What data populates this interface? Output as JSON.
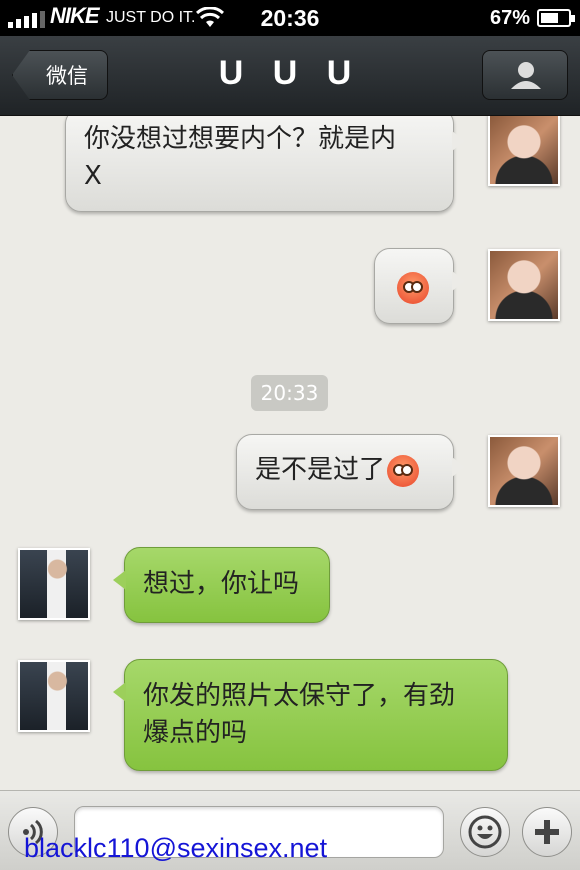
{
  "status_bar": {
    "carrier_logo": "NIKE",
    "carrier_text": "JUST DO IT.",
    "time": "20:36",
    "battery_percent": "67%",
    "battery_level": 0.67
  },
  "nav": {
    "back_label": "微信",
    "title": "U U U"
  },
  "messages": [
    {
      "side": "right",
      "sender": "her",
      "lines": [
        "你没想过想要内个？就是内",
        "X"
      ]
    },
    {
      "side": "right",
      "sender": "her",
      "emoji": "flushed-emoji"
    },
    {
      "side": "right",
      "sender": "her",
      "text": "是不是过了"
    },
    {
      "side": "left",
      "sender": "him",
      "text": "想过，你让吗"
    },
    {
      "side": "left",
      "sender": "him",
      "lines": [
        "你发的照片太保守了，有劲",
        "爆点的吗"
      ]
    }
  ],
  "timestamp": "20:33",
  "watermark": "blacklc110@sexinsex.net",
  "icons": {
    "voice": "voice-icon",
    "emoji": "smiley-icon",
    "add": "plus-icon",
    "profile": "person-icon",
    "wifi": "wifi-icon"
  }
}
